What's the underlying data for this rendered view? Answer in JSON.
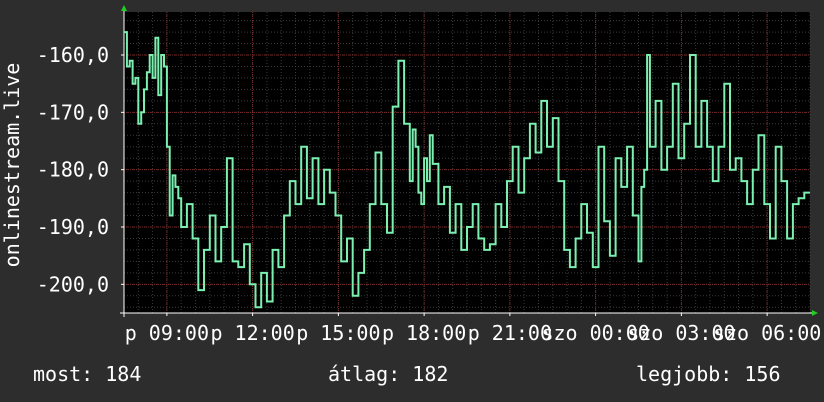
{
  "chart_data": {
    "type": "line",
    "title": "",
    "ylabel": "onlinestream.live",
    "xlabel": "",
    "ylim": [
      -205,
      -152.5
    ],
    "y_ticks": [
      -160,
      -170,
      -180,
      -190,
      -200
    ],
    "y_tick_labels": [
      "-160,0",
      "-170,0",
      "-180,0",
      "-190,0",
      "-200,0"
    ],
    "x_range": [
      0,
      24
    ],
    "x_ticks": [
      {
        "x": 1.5,
        "label": "p 09:00"
      },
      {
        "x": 4.5,
        "label": "p 12:00"
      },
      {
        "x": 7.5,
        "label": "p 15:00"
      },
      {
        "x": 10.5,
        "label": "p 18:00"
      },
      {
        "x": 13.5,
        "label": "p 21:00"
      },
      {
        "x": 16.5,
        "label": "szo 00:00"
      },
      {
        "x": 19.5,
        "label": "szo 03:00"
      },
      {
        "x": 22.5,
        "label": "szo 06:00"
      }
    ],
    "grid": true,
    "colors": {
      "line": "#7cf0b0",
      "plot_bg": "#000000",
      "page_bg": "#2d2d2d",
      "grid_major": "#7a2a2a",
      "grid_minor": "#3a3a3a",
      "axis_arrow": "#22cc22"
    },
    "series": [
      {
        "x": [
          0,
          0.1,
          0.2,
          0.3,
          0.4,
          0.5,
          0.6,
          0.7,
          0.8,
          0.9,
          1.0,
          1.1,
          1.2,
          1.3,
          1.4,
          1.5,
          1.6,
          1.7,
          1.8,
          1.9,
          2.0,
          2.2,
          2.4,
          2.6,
          2.8,
          3.0,
          3.2,
          3.4,
          3.6,
          3.8,
          4.0,
          4.2,
          4.4,
          4.6,
          4.8,
          5.0,
          5.2,
          5.4,
          5.6,
          5.8,
          6.0,
          6.2,
          6.4,
          6.6,
          6.8,
          7.0,
          7.2,
          7.4,
          7.6,
          7.8,
          8.0,
          8.2,
          8.4,
          8.6,
          8.8,
          9.0,
          9.2,
          9.4,
          9.6,
          9.8,
          10.0,
          10.1,
          10.2,
          10.3,
          10.4,
          10.5,
          10.6,
          10.7,
          10.8,
          11.0,
          11.2,
          11.4,
          11.6,
          11.8,
          12.0,
          12.2,
          12.4,
          12.6,
          12.8,
          13.0,
          13.2,
          13.4,
          13.6,
          13.8,
          14.0,
          14.2,
          14.4,
          14.6,
          14.8,
          15.0,
          15.2,
          15.4,
          15.6,
          15.8,
          16.0,
          16.2,
          16.4,
          16.6,
          16.8,
          17.0,
          17.2,
          17.4,
          17.6,
          17.8,
          18.0,
          18.1,
          18.2,
          18.3,
          18.4,
          18.6,
          18.8,
          19.0,
          19.2,
          19.4,
          19.6,
          19.8,
          20.0,
          20.2,
          20.4,
          20.6,
          20.8,
          21.0,
          21.2,
          21.4,
          21.6,
          21.8,
          22.0,
          22.2,
          22.4,
          22.6,
          22.8,
          23.0,
          23.2,
          23.4,
          23.6,
          23.8,
          24.0
        ],
        "y": [
          -156,
          -162,
          -161,
          -165,
          -164,
          -172,
          -170,
          -166,
          -163,
          -160,
          -164,
          -157,
          -167,
          -160,
          -162,
          -176,
          -188,
          -181,
          -183,
          -185,
          -190,
          -186,
          -192,
          -201,
          -194,
          -188,
          -196,
          -190,
          -178,
          -196,
          -197,
          -193,
          -200,
          -204,
          -198,
          -203,
          -194,
          -197,
          -188,
          -182,
          -186,
          -176,
          -185,
          -178,
          -186,
          -180,
          -184,
          -188,
          -196,
          -192,
          -202,
          -198,
          -194,
          -186,
          -177,
          -186,
          -191,
          -169,
          -161,
          -172,
          -182,
          -173,
          -176,
          -184,
          -186,
          -178,
          -182,
          -174,
          -179,
          -186,
          -183,
          -191,
          -186,
          -194,
          -190,
          -186,
          -192,
          -194,
          -193,
          -186,
          -190,
          -182,
          -176,
          -184,
          -178,
          -172,
          -177,
          -168,
          -176,
          -171,
          -182,
          -194,
          -197,
          -192,
          -186,
          -191,
          -197,
          -176,
          -189,
          -195,
          -178,
          -183,
          -176,
          -188,
          -196,
          -183,
          -180,
          -160,
          -176,
          -168,
          -180,
          -176,
          -165,
          -178,
          -172,
          -160,
          -176,
          -168,
          -176,
          -182,
          -176,
          -165,
          -180,
          -178,
          -182,
          -186,
          -180,
          -174,
          -186,
          -192,
          -176,
          -182,
          -192,
          -186,
          -185,
          -184,
          -184
        ]
      }
    ]
  },
  "footer": {
    "current": "most: 184",
    "average": "átlag: 182",
    "best": "legjobb: 156"
  }
}
